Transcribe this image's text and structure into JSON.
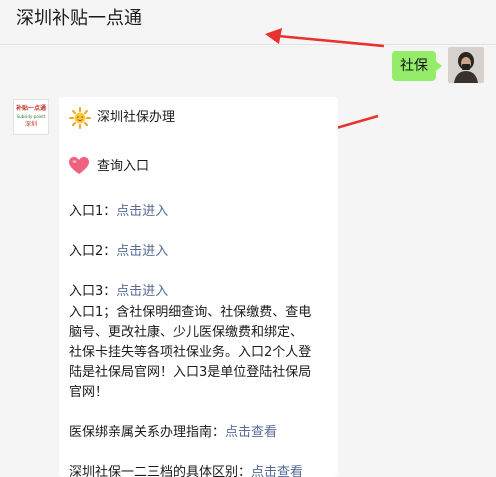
{
  "header": {
    "title": "深圳补贴一点通"
  },
  "outgoing": {
    "text": "社保"
  },
  "bot_avatar": {
    "line1": "补贴一点通",
    "line2": "Subsidy-pointt",
    "line3": "深圳"
  },
  "message": {
    "title": "深圳社保办理",
    "query_heading": "查询入口",
    "entries": [
      {
        "label": "入口1：",
        "link": "点击进入"
      },
      {
        "label": "入口2：",
        "link": "点击进入"
      },
      {
        "label": "入口3：",
        "link": "点击进入"
      }
    ],
    "description_lines": [
      "入口1；含社保明细查询、社保缴费、查电",
      "脑号、更改社康、少儿医保缴费和绑定、",
      "社保卡挂失等各项社保业务。入口2个人登",
      "陆是社保局官网！入口3是单位登陆社保局",
      "官网！"
    ],
    "guide": {
      "label": "医保绑亲属关系办理指南：",
      "link": "点击查看"
    },
    "cutoff": {
      "label": "深圳社保一二三档的具体区别：",
      "link": "点击查看"
    }
  },
  "colors": {
    "link": "#576b95",
    "outgoing_bubble": "#95ec69",
    "arrow": "#e8322d"
  }
}
